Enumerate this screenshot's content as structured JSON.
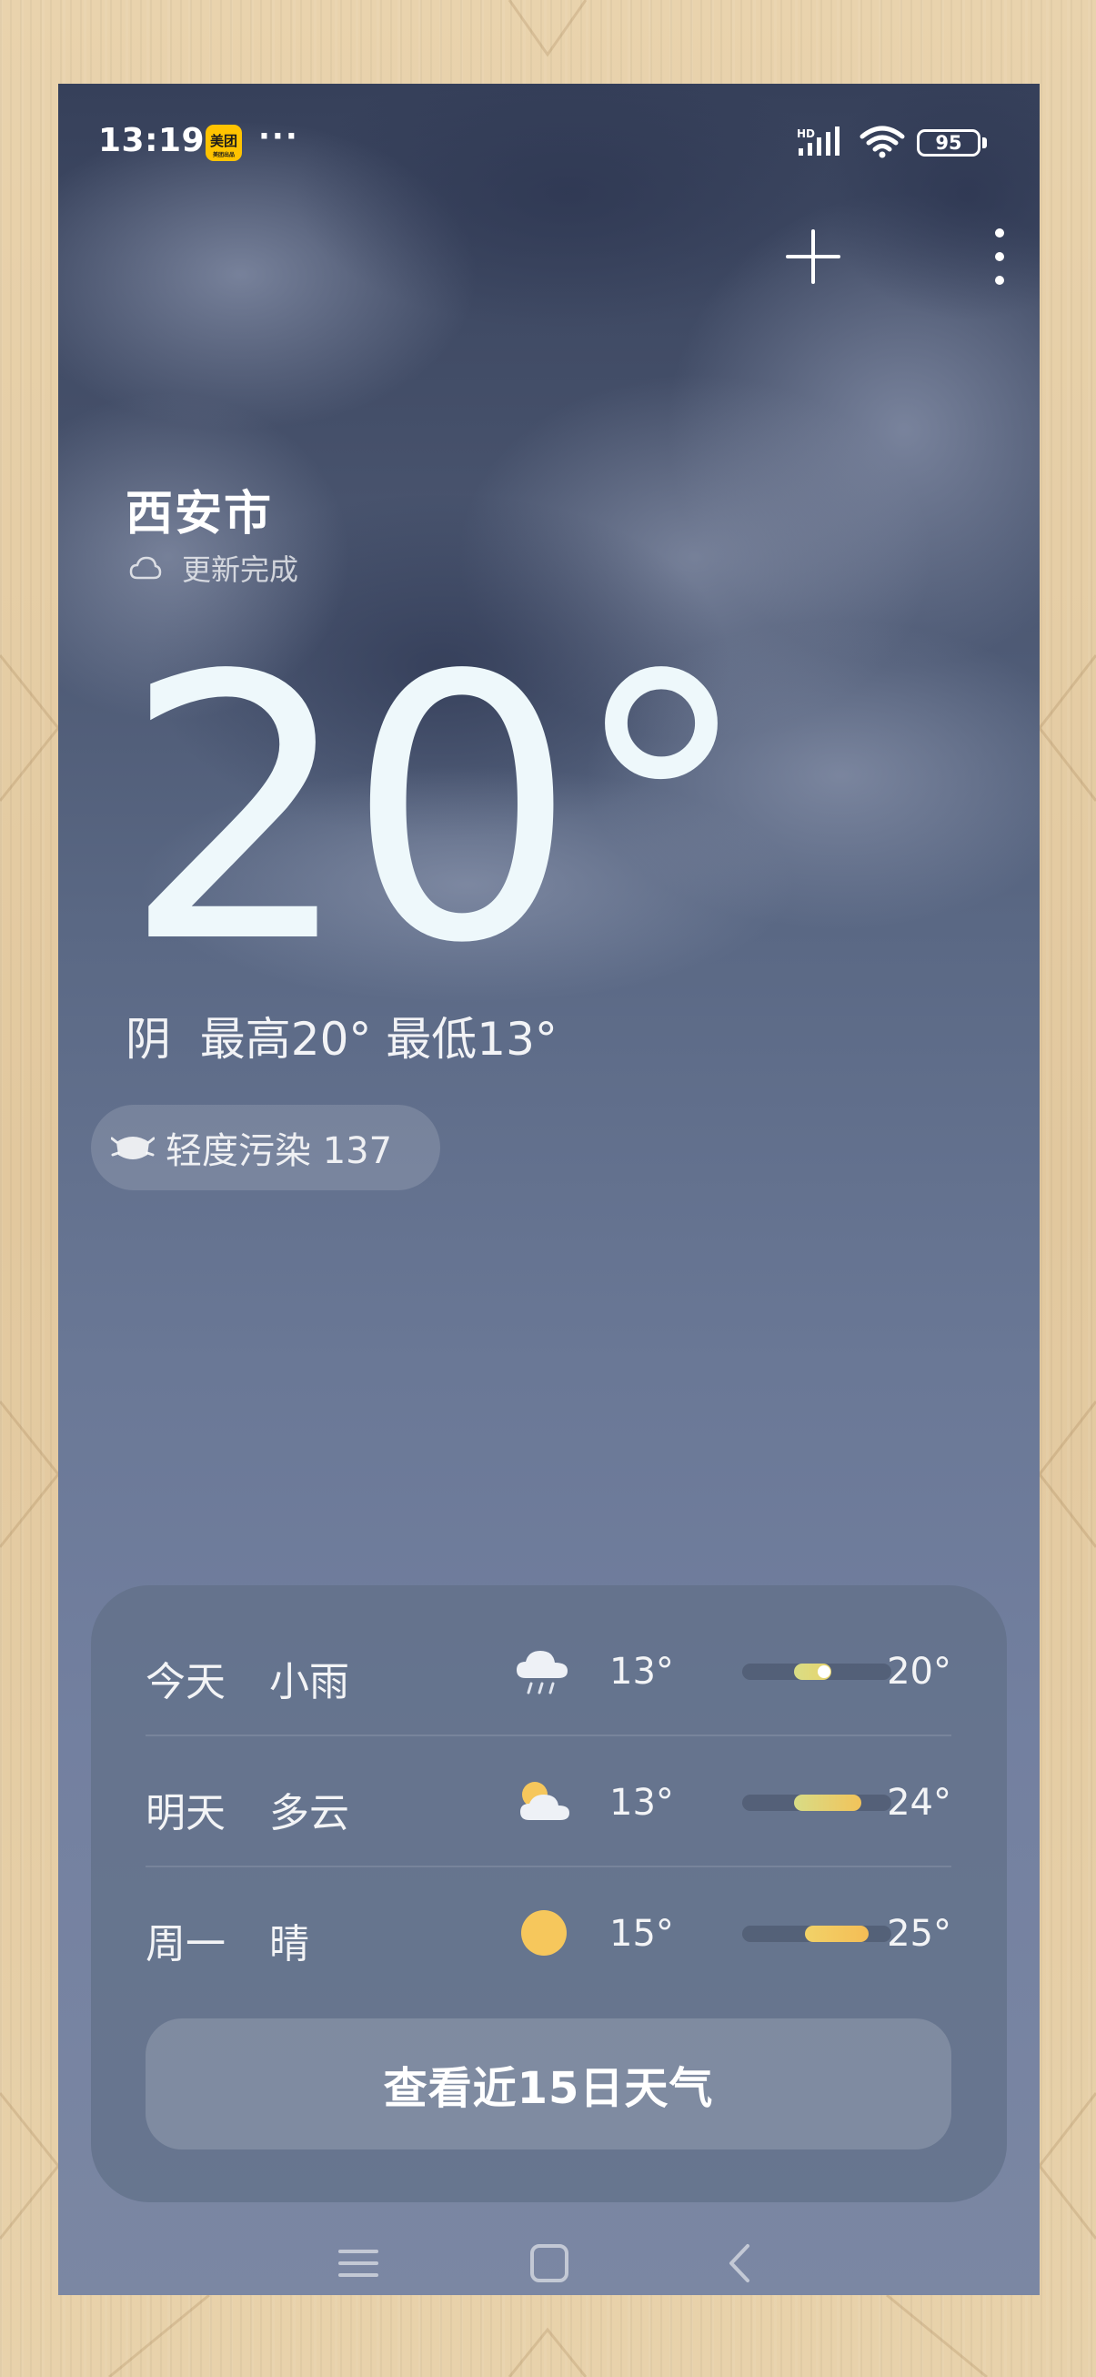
{
  "status_bar": {
    "time": "13:19",
    "app_badge": "美团",
    "app_badge_sub": "美团出品",
    "overflow": "···",
    "network": "HD",
    "battery": "95"
  },
  "top_actions": {
    "add_icon": "plus-icon",
    "more_icon": "more-vertical-icon"
  },
  "city": {
    "name": "西安市",
    "update_status": "更新完成",
    "update_icon": "cloud-outline-icon"
  },
  "current": {
    "temperature": "20°",
    "summary": "阴  最高20° 最低13°"
  },
  "air_quality": {
    "icon": "mask-icon",
    "label": "轻度污染 137"
  },
  "forecast": [
    {
      "day": "今天",
      "condition": "小雨",
      "icon": "light-rain-icon",
      "low": "13°",
      "high": "20°",
      "range_start": 0.35,
      "range_end": 0.6,
      "now": 0.55,
      "color_from": "#d9dd86",
      "color_to": "#e8d46b"
    },
    {
      "day": "明天",
      "condition": "多云",
      "icon": "partly-cloudy-icon",
      "low": "13°",
      "high": "24°",
      "range_start": 0.35,
      "range_end": 0.8,
      "color_from": "#d8dc86",
      "color_to": "#f2c35a"
    },
    {
      "day": "周一",
      "condition": "晴",
      "icon": "sun-icon",
      "low": "15°",
      "high": "25°",
      "range_start": 0.42,
      "range_end": 0.85,
      "color_from": "#f2d268",
      "color_to": "#f4bd55"
    }
  ],
  "forecast_button": "查看近15日天气",
  "nav": {
    "menu_icon": "menu-icon",
    "home_icon": "home-square-icon",
    "back_icon": "back-chevron-icon"
  },
  "colors": {
    "sky_top": "#36405a",
    "sky_bottom": "#7b87a3",
    "card": "#627088",
    "accent_yellow": "#f4c45a",
    "frame_wood": "#e6cfa7"
  }
}
